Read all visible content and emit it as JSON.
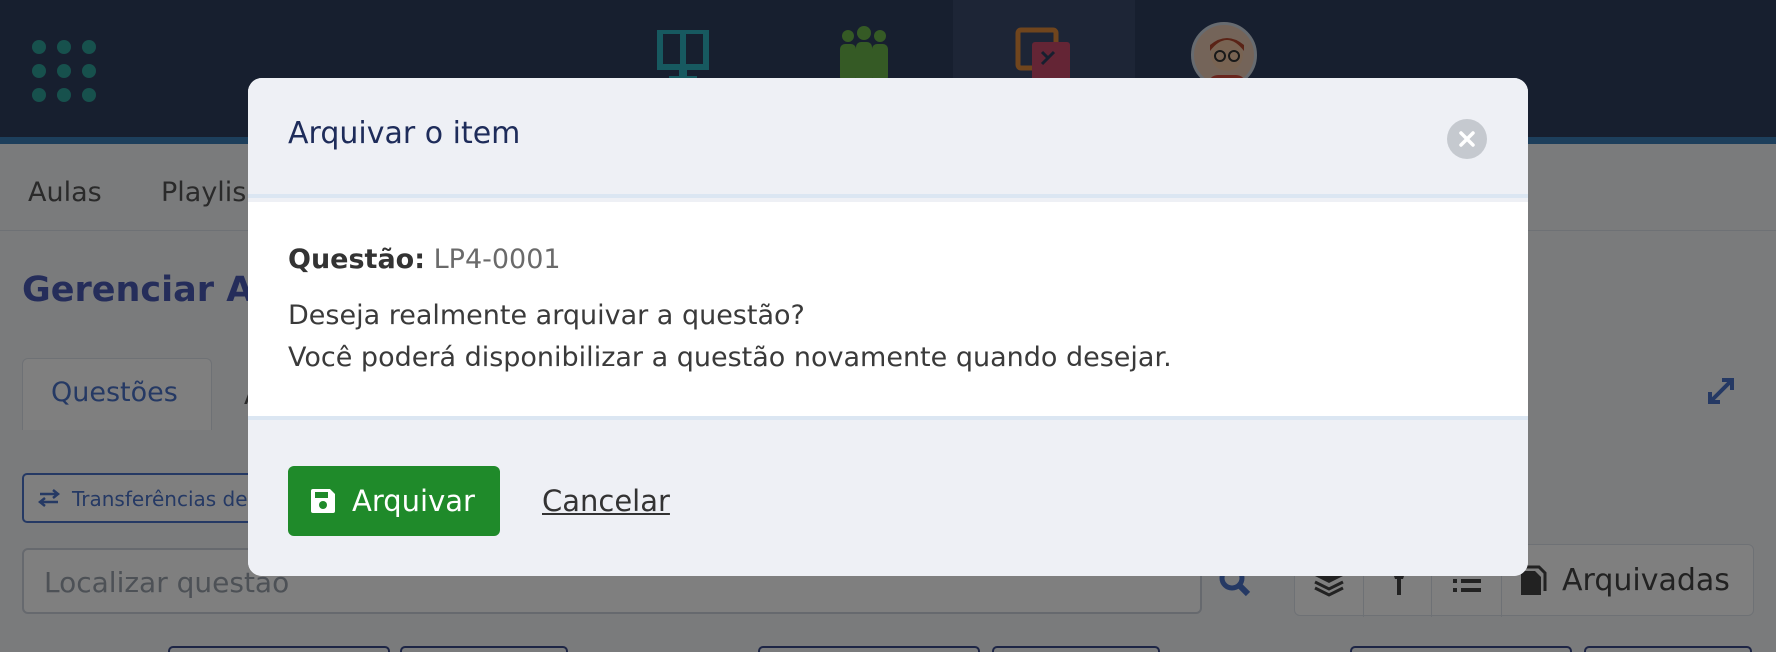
{
  "subnav": {
    "items": [
      "Aulas",
      "Playlis"
    ]
  },
  "page": {
    "title": "Gerenciar Av",
    "tabs": [
      "Questões",
      "A"
    ]
  },
  "toolbar": {
    "transfer_label": "Transferências de",
    "search_placeholder": "Localizar questão",
    "archived_label": "Arquivadas"
  },
  "modal": {
    "title": "Arquivar o item",
    "question_label": "Questão:",
    "question_code": "LP4-0001",
    "message_line1": "Deseja realmente arquivar a questão?",
    "message_line2": "Você poderá disponibilizar a questão novamente quando desejar.",
    "confirm_label": "Arquivar",
    "cancel_label": "Cancelar"
  },
  "colors": {
    "topbar": "#2f3e5e",
    "accent_blue": "#4a73c9",
    "confirm_green": "#1f8a2a",
    "modal_bg": "#eef0f5"
  },
  "icons": [
    "apps-grid-icon",
    "book-icon",
    "people-icon",
    "puzzle-icon",
    "user-avatar",
    "close-icon",
    "save-icon",
    "expand-icon",
    "transfer-icon",
    "search-icon",
    "layers-icon",
    "pin-icon",
    "list-icon",
    "file-icon"
  ]
}
